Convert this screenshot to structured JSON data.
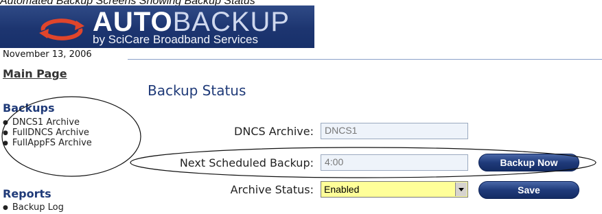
{
  "doc_title": "Automated Backup Screens Showing Backup Status",
  "brand": {
    "word_bold": "AUTO",
    "word_thin": "BACKUP",
    "tagline": "by SciCare Broadband Services"
  },
  "date": "November 13, 2006",
  "nav": {
    "main_page": "Main Page",
    "backups_heading": "Backups",
    "backups_items": [
      "DNCS1 Archive",
      "FullDNCS Archive",
      "FullAppFS Archive"
    ],
    "reports_heading": "Reports",
    "reports_items": [
      "Backup Log"
    ]
  },
  "main": {
    "title": "Backup Status",
    "dncs_archive_label": "DNCS Archive:",
    "dncs_archive_value": "DNCS1",
    "next_backup_label": "Next Scheduled Backup:",
    "next_backup_value": "4:00",
    "archive_status_label": "Archive Status:",
    "archive_status_value": "Enabled",
    "backup_now_label": "Backup Now",
    "save_label": "Save"
  },
  "colors": {
    "banner": "#1d3570",
    "accent_text": "#1f3a78",
    "select_bg": "#ffff99",
    "field_bg": "#eef3fa"
  }
}
